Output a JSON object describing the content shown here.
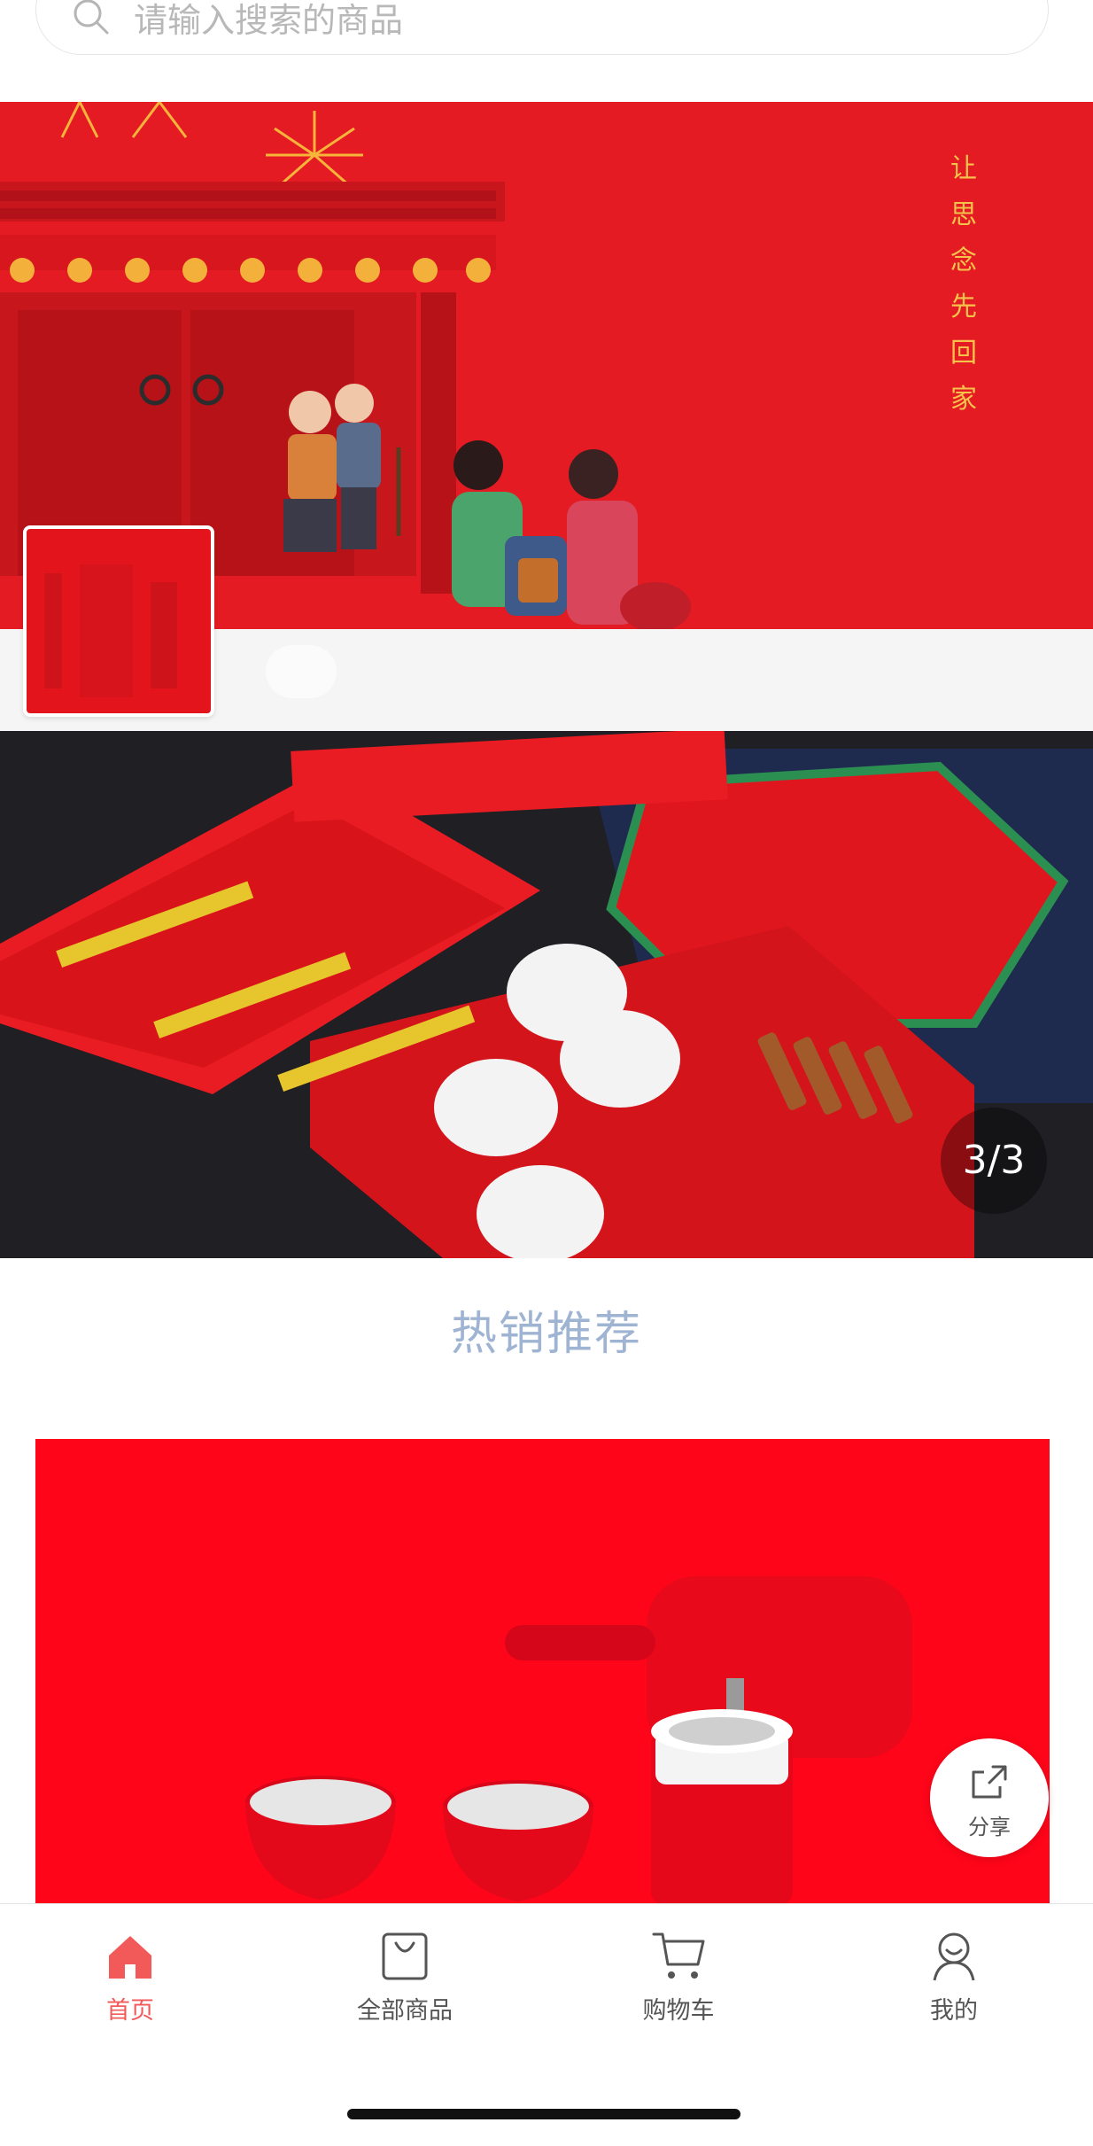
{
  "search": {
    "placeholder": "请输入搜索的商品"
  },
  "banner1": {
    "tagline": [
      "让",
      "思",
      "念",
      "先",
      "回",
      "家"
    ]
  },
  "carousel": {
    "counter": "3/3"
  },
  "section": {
    "title": "热销推荐"
  },
  "share": {
    "label": "分享"
  },
  "tabs": [
    {
      "label": "首页",
      "icon": "home-icon",
      "active": true
    },
    {
      "label": "全部商品",
      "icon": "shopping-bag-icon",
      "active": false
    },
    {
      "label": "购物车",
      "icon": "cart-icon",
      "active": false
    },
    {
      "label": "我的",
      "icon": "user-icon",
      "active": false
    }
  ],
  "colors": {
    "accent": "#f25a5a",
    "banner_red": "#e41b23",
    "product_red": "#ff0018",
    "title_blue": "#9fb4d3"
  }
}
